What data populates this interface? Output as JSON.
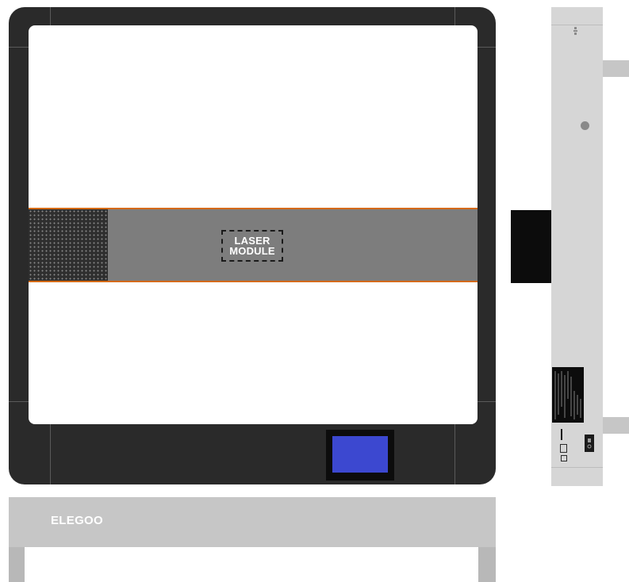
{
  "top_view": {
    "laser_module_label_line1": "LASER",
    "laser_module_label_line2": "MODULE",
    "screen_color": "#3c48d0",
    "gantry_accent_color": "#d46a12"
  },
  "front_view": {
    "brand": "ELEGOO"
  },
  "icons": {
    "side_power_switch": "power-switch-icon",
    "side_usb": "usb-port-icon",
    "side_power_jack": "power-jack-icon"
  }
}
